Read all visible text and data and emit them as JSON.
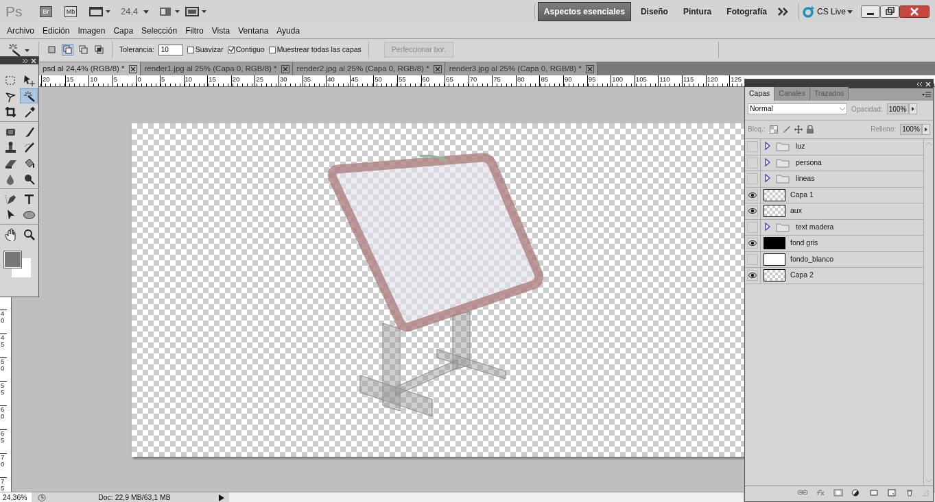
{
  "app": {
    "logo": "Ps",
    "bridge": "Br",
    "mini_bridge": "Mb",
    "zoom": "24,4",
    "cs_live": "CS Live",
    "workspaces": [
      {
        "label": "Aspectos esenciales",
        "selected": true
      },
      {
        "label": "Diseño",
        "selected": false
      },
      {
        "label": "Pintura",
        "selected": false
      },
      {
        "label": "Fotografía",
        "selected": false
      }
    ]
  },
  "menu": [
    "Archivo",
    "Edición",
    "Imagen",
    "Capa",
    "Selección",
    "Filtro",
    "Vista",
    "Ventana",
    "Ayuda"
  ],
  "options": {
    "modes": [
      {
        "kind": "new",
        "selected": false
      },
      {
        "kind": "add",
        "selected": true
      },
      {
        "kind": "subtract",
        "selected": false
      },
      {
        "kind": "intersect",
        "selected": false
      }
    ],
    "tolerance_label": "Tolerancia:",
    "tolerance": "10",
    "checkboxes": [
      {
        "label": "Suavizar",
        "checked": false
      },
      {
        "label": "Contiguo",
        "checked": true
      },
      {
        "label": "Muestrear todas las capas",
        "checked": false
      }
    ],
    "refine": {
      "label": "Perfeccionar bor.",
      "disabled": true
    }
  },
  "document_tabs": [
    {
      "title": "psd al 24,4% (RGB/8) *",
      "selected": true
    },
    {
      "title": "render1.jpg al 25% (Capa 0, RGB/8) *",
      "selected": false
    },
    {
      "title": "render2.jpg al 25% (Capa 0, RGB/8) *",
      "selected": false
    },
    {
      "title": "render3.jpg al 25% (Capa 0, RGB/8) *",
      "selected": false
    }
  ],
  "rulers": {
    "horizontal": [
      "20",
      "15",
      "10",
      "5",
      "0",
      "5",
      "10",
      "15",
      "20",
      "25",
      "30",
      "35",
      "40",
      "45",
      "50",
      "55",
      "60",
      "65",
      "70",
      "75",
      "80",
      "85",
      "90",
      "95",
      "100",
      "105",
      "110",
      "115",
      "120",
      "125"
    ],
    "vertical": [
      "40",
      "45",
      "50",
      "55",
      "60",
      "65",
      "70",
      "75"
    ]
  },
  "tools": [
    {
      "kind": "marquee",
      "selected": false
    },
    {
      "kind": "move",
      "selected": false
    },
    {
      "kind": "lasso",
      "selected": false
    },
    {
      "kind": "wand",
      "selected": true
    },
    {
      "kind": "crop",
      "selected": false
    },
    {
      "kind": "eyedropper",
      "selected": false
    },
    {
      "kind": "healing",
      "selected": false
    },
    {
      "kind": "brush",
      "selected": false
    },
    {
      "kind": "stamp",
      "selected": false
    },
    {
      "kind": "history",
      "selected": false
    },
    {
      "kind": "eraser",
      "selected": false
    },
    {
      "kind": "bucket",
      "selected": false
    },
    {
      "kind": "blur",
      "selected": false
    },
    {
      "kind": "dodge",
      "selected": false
    },
    {
      "kind": "pen",
      "selected": false
    },
    {
      "kind": "type",
      "selected": false
    },
    {
      "kind": "pointer",
      "selected": false
    },
    {
      "kind": "ellipse",
      "selected": false
    },
    {
      "kind": "hand",
      "selected": false
    },
    {
      "kind": "zoom",
      "selected": false
    }
  ],
  "layers_panel": {
    "tabs": [
      {
        "label": "Capas",
        "selected": true
      },
      {
        "label": "Canales",
        "selected": false
      },
      {
        "label": "Trazados",
        "selected": false
      }
    ],
    "blend_mode": "Normal",
    "opacity_label": "Opacidad:",
    "opacity": "100%",
    "lock_label": "Bloq.:",
    "fill_label": "Relleno:",
    "fill": "100%",
    "layers": [
      {
        "name": "luz",
        "kind": "group",
        "visible": false
      },
      {
        "name": "persona",
        "kind": "group",
        "visible": false
      },
      {
        "name": "lineas",
        "kind": "group",
        "visible": false
      },
      {
        "name": "Capa 1",
        "kind": "checker",
        "visible": true
      },
      {
        "name": "aux",
        "kind": "checker",
        "visible": true
      },
      {
        "name": "text madera",
        "kind": "group",
        "visible": false
      },
      {
        "name": "fond gris",
        "kind": "black",
        "visible": true
      },
      {
        "name": "fondo_blanco",
        "kind": "white",
        "visible": false
      },
      {
        "name": "Capa 2",
        "kind": "checker",
        "visible": true
      }
    ]
  },
  "status_bar": {
    "zoom": "24,36%",
    "doc": "Doc: 22,9 MB/63,1 MB"
  }
}
